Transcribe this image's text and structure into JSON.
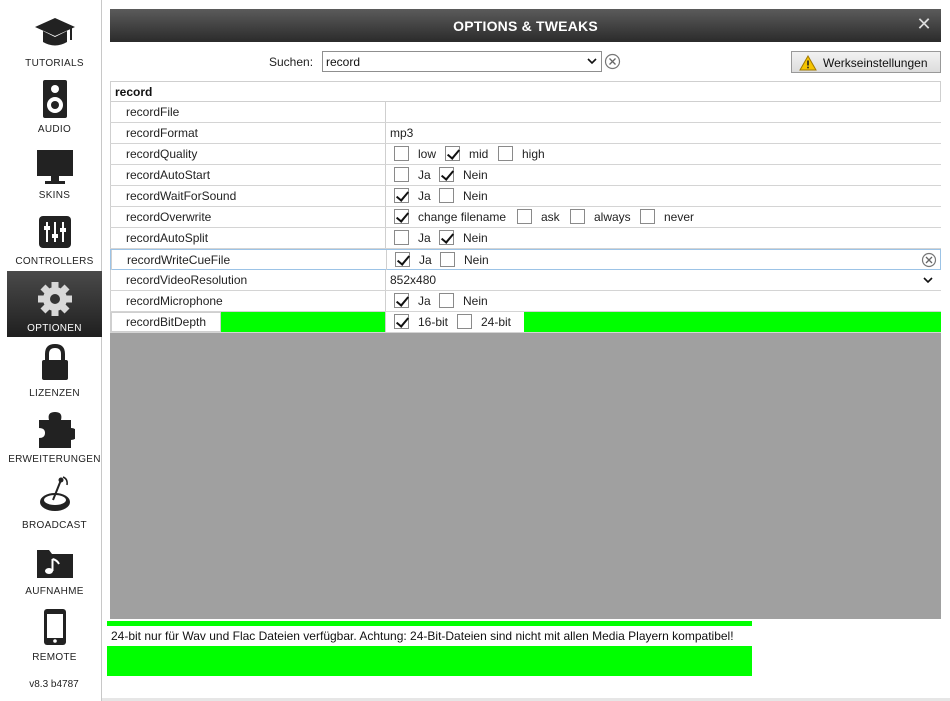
{
  "sidebar": {
    "items": [
      {
        "label": "TUTORIALS",
        "icon": "graduation-cap-icon"
      },
      {
        "label": "AUDIO",
        "icon": "speaker-icon"
      },
      {
        "label": "SKINS",
        "icon": "monitor-icon"
      },
      {
        "label": "CONTROLLERS",
        "icon": "sliders-icon"
      },
      {
        "label": "OPTIONEN",
        "icon": "gear-icon",
        "active": true
      },
      {
        "label": "LIZENZEN",
        "icon": "lock-icon"
      },
      {
        "label": "ERWEITERUNGEN",
        "icon": "puzzle-icon"
      },
      {
        "label": "BROADCAST",
        "icon": "satellite-dish-icon"
      },
      {
        "label": "AUFNAHME",
        "icon": "music-folder-icon"
      },
      {
        "label": "REMOTE",
        "icon": "smartphone-icon"
      }
    ],
    "version": "v8.3 b4787"
  },
  "window": {
    "title": "OPTIONS & TWEAKS"
  },
  "search": {
    "label": "Suchen:",
    "value": "record"
  },
  "reset_button": {
    "label": "Werkseinstellungen"
  },
  "group": {
    "name": "record"
  },
  "rows": {
    "recordFile": {
      "name": "recordFile",
      "value": ""
    },
    "recordFormat": {
      "name": "recordFormat",
      "value": "mp3"
    },
    "recordQuality": {
      "name": "recordQuality",
      "options": [
        "low",
        "mid",
        "high"
      ],
      "selected": "mid"
    },
    "recordAutoStart": {
      "name": "recordAutoStart",
      "options": [
        "Ja",
        "Nein"
      ],
      "selected": "Nein"
    },
    "recordWaitForSound": {
      "name": "recordWaitForSound",
      "options": [
        "Ja",
        "Nein"
      ],
      "selected": "Ja"
    },
    "recordOverwrite": {
      "name": "recordOverwrite",
      "options": [
        "change filename",
        "ask",
        "always",
        "never"
      ],
      "selected": "change filename"
    },
    "recordAutoSplit": {
      "name": "recordAutoSplit",
      "options": [
        "Ja",
        "Nein"
      ],
      "selected": "Nein"
    },
    "recordWriteCueFile": {
      "name": "recordWriteCueFile",
      "options": [
        "Ja",
        "Nein"
      ],
      "selected": "Ja"
    },
    "recordVideoResolution": {
      "name": "recordVideoResolution",
      "value": "852x480"
    },
    "recordMicrophone": {
      "name": "recordMicrophone",
      "options": [
        "Ja",
        "Nein"
      ],
      "selected": "Ja"
    },
    "recordBitDepth": {
      "name": "recordBitDepth",
      "options": [
        "16-bit",
        "24-bit"
      ],
      "selected": "16-bit"
    }
  },
  "info": {
    "text": "24-bit nur für Wav und Flac Dateien verfügbar. Achtung: 24-Bit-Dateien sind nicht mit allen Media Playern kompatibel!"
  },
  "colors": {
    "highlight": "#00ff00",
    "title_bar": "#3a3a3a",
    "empty_area": "#a0a0a0"
  }
}
